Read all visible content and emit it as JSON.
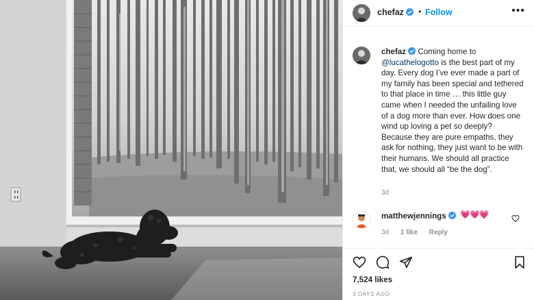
{
  "post": {
    "author": "chefaz",
    "follow_label": "Follow",
    "more_label": "•••",
    "caption_before": " Coming home to ",
    "mention": "@lucathelogotto",
    "caption_after": " is the best part of my day. Every dog I’ve ever made a part of my family has been special and tethered to that place in time … this little guy came when I needed the unfailing love of a dog more than ever. How does one wind up loving a pet so deeply? Because they are pure empaths, they ask for nothing, they just want to be with their humans. We should all practice that, we should all “be the dog”.",
    "caption_time": "3d",
    "likes": "7,524 likes",
    "posted": "3 DAYS AGO"
  },
  "comment": {
    "user": "matthewjennings",
    "text": "💗💗💗",
    "time": "3d",
    "likes": "1 like",
    "reply_label": "Reply"
  },
  "icons": {
    "verified": "verified-badge-icon",
    "like": "heart-outline-icon",
    "comment": "comment-bubble-icon",
    "share": "paper-plane-icon",
    "save": "bookmark-icon"
  },
  "colors": {
    "accent": "#0095f6",
    "text": "#262626",
    "muted": "#8e8e8e",
    "mention": "#00376b"
  }
}
